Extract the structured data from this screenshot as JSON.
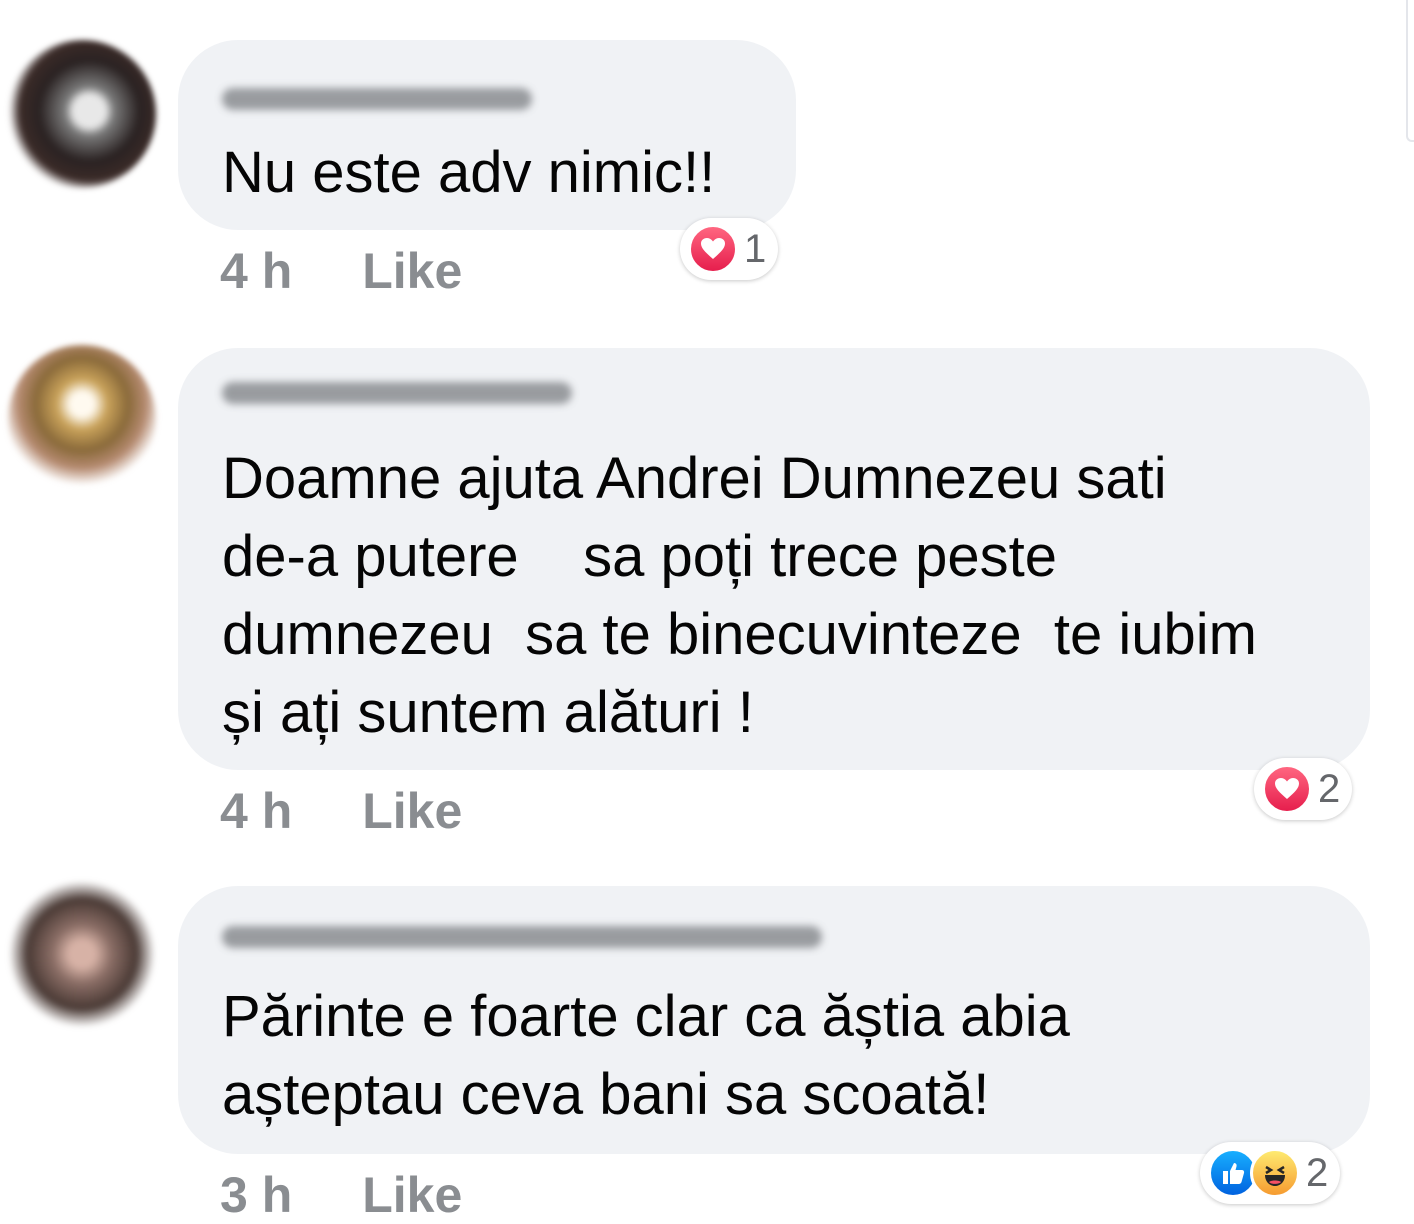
{
  "comments": [
    {
      "text": "Nu este adv nimic!!",
      "time": "4 h",
      "like_label": "Like",
      "reactions": {
        "icons": [
          "love-icon"
        ],
        "count": "1"
      }
    },
    {
      "text": "Doamne ajuta Andrei Dumnezeu sati\nde-a putere    sa poți trece peste\ndumnezeu  sa te binecuvinteze  te iubim\nși ați suntem alături !",
      "time": "4 h",
      "like_label": "Like",
      "reactions": {
        "icons": [
          "love-icon"
        ],
        "count": "2"
      }
    },
    {
      "text": "Părinte e foarte clar ca ăștia abia\naștepta​u ceva bani sa scoată!",
      "time": "3 h",
      "like_label": "Like",
      "reactions": {
        "icons": [
          "like-icon",
          "haha-icon"
        ],
        "count": "2"
      }
    }
  ],
  "colors": {
    "bubble": "#f0f2f5",
    "meta_text": "#8a8d91",
    "love": "#f33e58",
    "like": "#1877f2",
    "haha": "#f7b125"
  }
}
